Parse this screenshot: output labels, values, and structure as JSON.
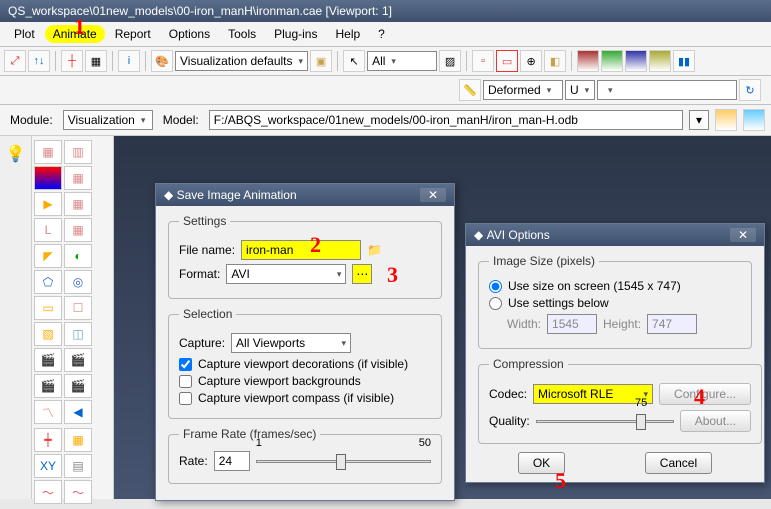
{
  "window": {
    "title": "QS_workspace\\01new_models\\00-iron_manH\\ironman.cae [Viewport: 1]"
  },
  "menu": {
    "items": [
      "Plot",
      "Animate",
      "Report",
      "Options",
      "Tools",
      "Plug-ins",
      "Help",
      "?"
    ],
    "highlighted_index": 1
  },
  "toolbar1": {
    "viz_label": "Visualization defaults",
    "filter": "All"
  },
  "toolbar2": {
    "deform_label": "Deformed",
    "u_label": "U"
  },
  "context": {
    "module_label": "Module:",
    "module_value": "Visualization",
    "model_label": "Model:",
    "model_value": "F:/ABQS_workspace/01new_models/00-iron_manH/iron_man-H.odb"
  },
  "dialog_save": {
    "title": "Save Image Animation",
    "settings_legend": "Settings",
    "filename_label": "File name:",
    "filename_value": "iron-man",
    "format_label": "Format:",
    "format_value": "AVI",
    "selection_legend": "Selection",
    "capture_label": "Capture:",
    "capture_value": "All Viewports",
    "chk_decorations": "Capture viewport decorations (if visible)",
    "chk_backgrounds": "Capture viewport backgrounds",
    "chk_compass": "Capture viewport compass (if visible)",
    "framerate_legend": "Frame Rate (frames/sec)",
    "rate_label": "Rate:",
    "rate_value": "24",
    "rate_min": "1",
    "rate_max": "50"
  },
  "dialog_avi": {
    "title": "AVI Options",
    "imgsize_legend": "Image Size (pixels)",
    "opt_screen": "Use size on screen (1545 x 747)",
    "opt_below": "Use settings below",
    "width_label": "Width:",
    "width_value": "1545",
    "height_label": "Height:",
    "height_value": "747",
    "compression_legend": "Compression",
    "codec_label": "Codec:",
    "codec_value": "Microsoft RLE",
    "configure_label": "Configure...",
    "quality_label": "Quality:",
    "quality_value": "75",
    "about_label": "About...",
    "ok_label": "OK",
    "cancel_label": "Cancel"
  },
  "annotations": {
    "a1": "1",
    "a2": "2",
    "a3": "3",
    "a4": "4",
    "a5": "5"
  }
}
